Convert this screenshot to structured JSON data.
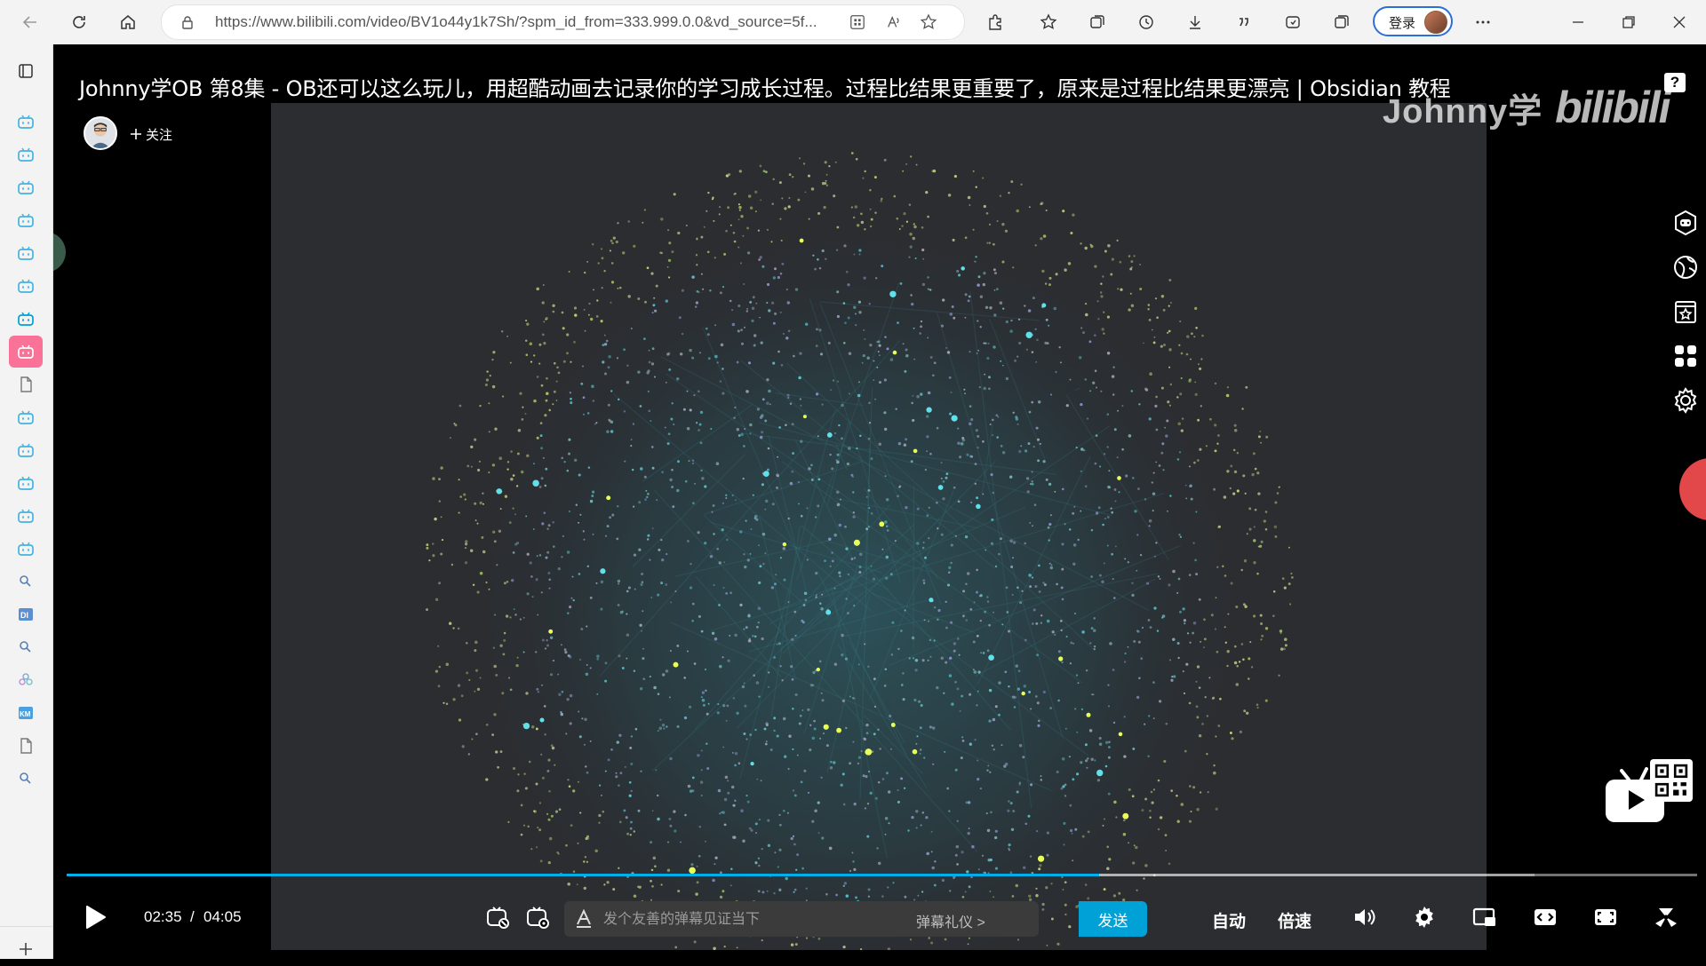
{
  "browser": {
    "url": "https://www.bilibili.com/video/BV1o44y1k7Sh/?spm_id_from=333.999.0.0&vd_source=5f...",
    "login_label": "登录"
  },
  "video": {
    "title": "Johnny学OB 第8集 - OB还可以这么玩儿，用超酷动画去记录你的学习成长过程。过程比结果更重要了，原来是过程比结果更漂亮 | Obsidian 教程",
    "follow_label": "关注",
    "watermark_text": "Johnny学",
    "watermark_brand": "bilibili",
    "help_label": "?"
  },
  "player": {
    "time_current": "02:35",
    "time_separator": "/",
    "time_total": "04:05",
    "progress_fraction": 0.633,
    "buffer_fraction": 0.9,
    "danmaku_placeholder": "发个友善的弹幕见证当下",
    "danmaku_etiquette": "弹幕礼仪 >",
    "send_label": "发送",
    "quality_label": "自动",
    "speed_label": "倍速"
  },
  "colors": {
    "accent_blue": "#00aeec",
    "send_blue": "#00a1d6",
    "bilibili_pink": "#fb7299",
    "graph_background": "#2b2d31"
  },
  "icons": {
    "sidebar": [
      "tab-actions-icon",
      "bilibili-tv-icon",
      "bilibili-tv-icon",
      "bilibili-tv-icon",
      "bilibili-tv-icon",
      "bilibili-tv-icon",
      "bilibili-tv-icon",
      "bilibili-tv-icon",
      "bilibili-tv-icon",
      "document-icon",
      "bilibili-tv-icon",
      "bilibili-tv-icon",
      "bilibili-tv-icon",
      "bilibili-tv-icon",
      "bilibili-tv-icon",
      "search-icon",
      "di-app-icon",
      "search-icon",
      "flower-icon",
      "km-app-icon",
      "document-icon",
      "search-icon"
    ],
    "right_tools": [
      "robot-icon",
      "globe-icon",
      "bookmark-star-icon",
      "apps-icon",
      "gear-icon"
    ]
  }
}
